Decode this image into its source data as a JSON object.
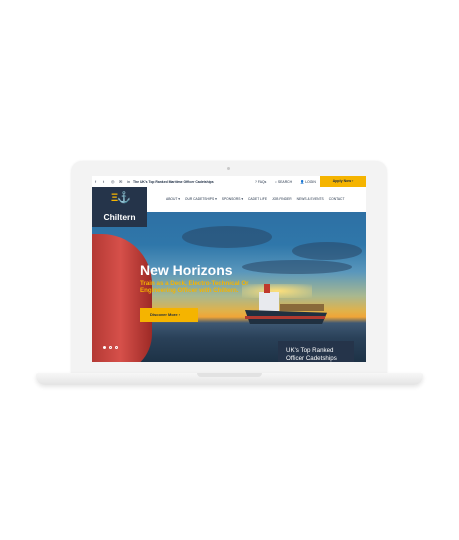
{
  "topbar": {
    "social_icons": [
      "facebook-icon",
      "twitter-icon",
      "instagram-icon",
      "email-icon",
      "linkedin-icon"
    ],
    "tagline": "The UK's Top Ranked Maritime Officer Cadetships",
    "faqs": "FAQs",
    "search": "SEARCH",
    "login": "LOGIN",
    "apply": "Apply Now ›"
  },
  "logo": {
    "name": "Chiltern"
  },
  "nav": {
    "items": [
      "ABOUT ▾",
      "OUR CADETSHIPS ▾",
      "SPONSORS ▾",
      "CADET LIFE",
      "JOB FINDER",
      "NEWS & EVENTS",
      "CONTACT"
    ]
  },
  "hero": {
    "title": "New Horizons",
    "subtitle": "Train as a Deck, Electro-Technical Or Engineering Officer with Chiltern.",
    "cta": "Discover More ›",
    "ranked": "UK's Top Ranked Officer Cadetships",
    "slide_count": 3,
    "active_slide": 1
  },
  "colors": {
    "brand_navy": "#25344a",
    "accent_yellow": "#f5b400"
  }
}
